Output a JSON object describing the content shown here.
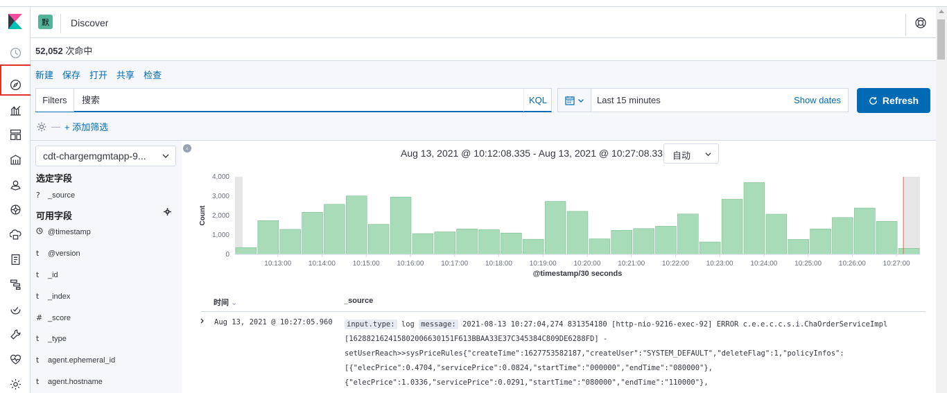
{
  "header": {
    "space_initial": "默",
    "app_title": "Discover"
  },
  "hits": {
    "count": "52,052",
    "label": "次命中"
  },
  "menu": {
    "new": "新建",
    "save": "保存",
    "open": "打开",
    "share": "共享",
    "inspect": "检查"
  },
  "search": {
    "filters_label": "Filters",
    "placeholder": "搜索",
    "kql_label": "KQL"
  },
  "datepicker": {
    "range_label": "Last 15 minutes",
    "show_dates": "Show dates"
  },
  "refresh": {
    "label": "Refresh"
  },
  "filters": {
    "add_label": "+ 添加筛选"
  },
  "sidebar": {
    "index_pattern": "cdt-chargemgmtapp-9...",
    "selected_title": "选定字段",
    "selected_fields": [
      {
        "type": "?",
        "name": "_source"
      }
    ],
    "available_title": "可用字段",
    "available_fields": [
      {
        "type": "clock",
        "name": "@timestamp"
      },
      {
        "type": "t",
        "name": "@version"
      },
      {
        "type": "t",
        "name": "_id"
      },
      {
        "type": "t",
        "name": "_index"
      },
      {
        "type": "#",
        "name": "_score"
      },
      {
        "type": "t",
        "name": "_type"
      },
      {
        "type": "t",
        "name": "agent.ephemeral_id"
      },
      {
        "type": "t",
        "name": "agent.hostname"
      }
    ]
  },
  "histogram": {
    "range_text": "Aug 13, 2021 @ 10:12:08.335 - Aug 13, 2021 @ 10:27:08.335 —",
    "interval": "自动"
  },
  "chart_data": {
    "type": "bar",
    "ylabel": "Count",
    "xlabel": "@timestamp/30 seconds",
    "ylim": [
      0,
      4000
    ],
    "y_ticks": [
      "0",
      "1,000",
      "2,000",
      "3,000",
      "4,000"
    ],
    "x_ticks": [
      "10:13:00",
      "10:14:00",
      "10:15:00",
      "10:16:00",
      "10:17:00",
      "10:18:00",
      "10:19:00",
      "10:20:00",
      "10:21:00",
      "10:22:00",
      "10:23:00",
      "10:24:00",
      "10:25:00",
      "10:26:00",
      "10:27:00"
    ],
    "values": [
      350,
      1740,
      1290,
      2170,
      2580,
      3010,
      1550,
      2950,
      1070,
      1160,
      1310,
      1270,
      1100,
      780,
      2730,
      2220,
      800,
      1240,
      1330,
      1450,
      2080,
      640,
      2840,
      3700,
      2070,
      770,
      1310,
      1900,
      2390,
      1700,
      310
    ],
    "color": "#a8dcb8",
    "grid": false
  },
  "table": {
    "col_time": "时间",
    "col_source": "_source",
    "row": {
      "time": "Aug 13, 2021 @ 10:27:05.960",
      "k1": "input.type:",
      "v1": "log",
      "k2": "message:",
      "line1": "2021-08-13 10:27:04,274 831354180 [http-nio-9216-exec-92] ERROR c.e.e.c.c.s.i.ChaOrderServiceImpl",
      "line2": "[162882162415802006630151F613BBAA33E37C345384C809DE6288FD] -",
      "line3": "setUserReach>>sysPriceRules{\"createTime\":1627753582187,\"createUser\":\"SYSTEM_DEFAULT\",\"deleteFlag\":1,\"policyInfos\":",
      "line4": "[{\"elecPrice\":0.4704,\"servicePrice\":0.0824,\"startTime\":\"000000\",\"endTime\":\"080000\"},",
      "line5": "{\"elecPrice\":1.0336,\"servicePrice\":0.0291,\"startTime\":\"080000\",\"endTime\":\"110000\"},"
    }
  }
}
